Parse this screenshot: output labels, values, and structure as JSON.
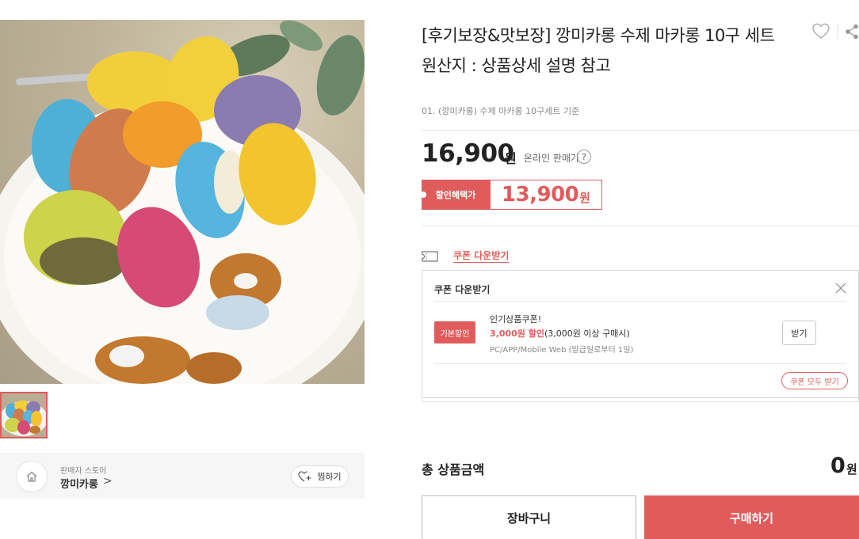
{
  "product": {
    "title_line1": "[후기보장&맛보장] 깡미카롱 수제 마카롱 10구 세트",
    "title_line2": "원산지 : 상품상세 설명 참고",
    "option": "01. (깡미카롱) 수제 마카롱 10구세트 기준",
    "price": "16,900",
    "price_unit": "원",
    "online_label": "온라인 판매가",
    "help_glyph": "?",
    "discount_label": "할인혜택가",
    "discount_price": "13,900",
    "discount_unit": "원",
    "accent_color": "#e05c5c"
  },
  "icons": {
    "wish": "heart-icon",
    "share": "share-icon",
    "coupon": "ticket-icon",
    "close": "close-icon",
    "home": "home-icon",
    "chevron": "chevron-right-icon",
    "wish_add": "heart-plus-icon"
  },
  "coupon": {
    "link_label": "쿠폰 다운받기",
    "panel_title": "쿠폰 다운받기",
    "items": [
      {
        "badge": "기본할인",
        "name": "인기상품쿠폰!",
        "amount": "3,000원 할인",
        "condition": "(3,000원 이상 구매시)",
        "meta": "PC/APP/Mobile Web (발급일로부터 1일)",
        "get_label": "받기"
      }
    ],
    "get_all_label": "쿠폰 모두 받기"
  },
  "store": {
    "label": "판매자 스토어",
    "name": "깡미카롱",
    "chevron": ">",
    "wish_label": "찜하기"
  },
  "summary": {
    "total_label": "총 상품금액",
    "total_value": "0",
    "total_unit": "원"
  },
  "actions": {
    "cart_label": "장바구니",
    "buy_label": "구매하기"
  }
}
